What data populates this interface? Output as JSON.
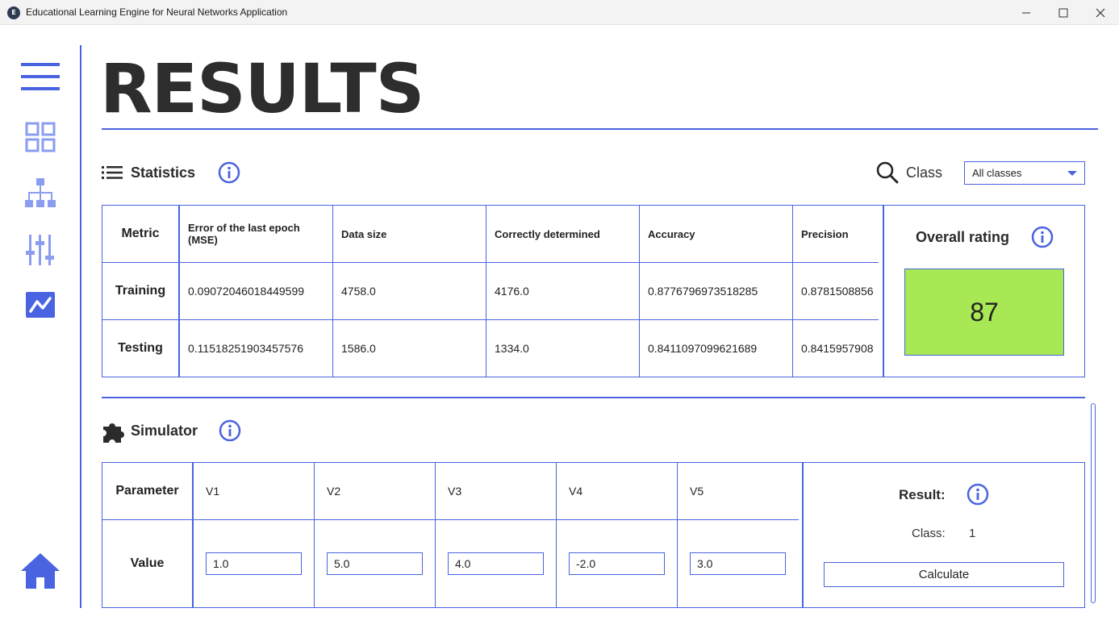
{
  "window": {
    "title": "Educational Learning Engine for Neural Networks Application",
    "app_icon_glyph": "E",
    "controls": [
      "minimize-icon",
      "maximize-icon",
      "close-icon"
    ]
  },
  "sidebar": {
    "items": [
      {
        "id": "menu",
        "icon": "hamburger-menu-icon"
      },
      {
        "id": "dashboard",
        "icon": "grid-icon"
      },
      {
        "id": "network",
        "icon": "network-tree-icon"
      },
      {
        "id": "settings",
        "icon": "sliders-icon"
      },
      {
        "id": "results",
        "icon": "chart-line-icon",
        "active": true
      },
      {
        "id": "home",
        "icon": "home-icon"
      }
    ]
  },
  "page": {
    "title": "RESULTS"
  },
  "statistics": {
    "heading": "Statistics",
    "class_filter_label": "Class",
    "class_filter_value": "All classes",
    "headers": [
      "Metric",
      "Error of the last epoch\n(MSE)",
      "Data size",
      "Correctly determined",
      "Accuracy",
      "Precision"
    ],
    "rows": [
      {
        "label": "Training",
        "values": [
          "0.09072046018449599",
          "4758.0",
          "4176.0",
          "0.8776796973518285",
          "0.8781508856"
        ]
      },
      {
        "label": "Testing",
        "values": [
          "0.11518251903457576",
          "1586.0",
          "1334.0",
          "0.8411097099621689",
          "0.8415957908"
        ]
      }
    ],
    "overall_rating_label": "Overall rating",
    "overall_rating_value": "87"
  },
  "simulator": {
    "heading": "Simulator",
    "param_header": "Parameter",
    "value_header": "Value",
    "params": [
      "V1",
      "V2",
      "V3",
      "V4",
      "V5"
    ],
    "values": [
      "1.0",
      "5.0",
      "4.0",
      "-2.0",
      "3.0"
    ],
    "result_label": "Result:",
    "class_label": "Class:",
    "class_value": "1",
    "calculate_label": "Calculate"
  },
  "colors": {
    "accent": "#4a63e0",
    "icon_light": "#8b9df0",
    "rating_fill": "#a8e854"
  }
}
